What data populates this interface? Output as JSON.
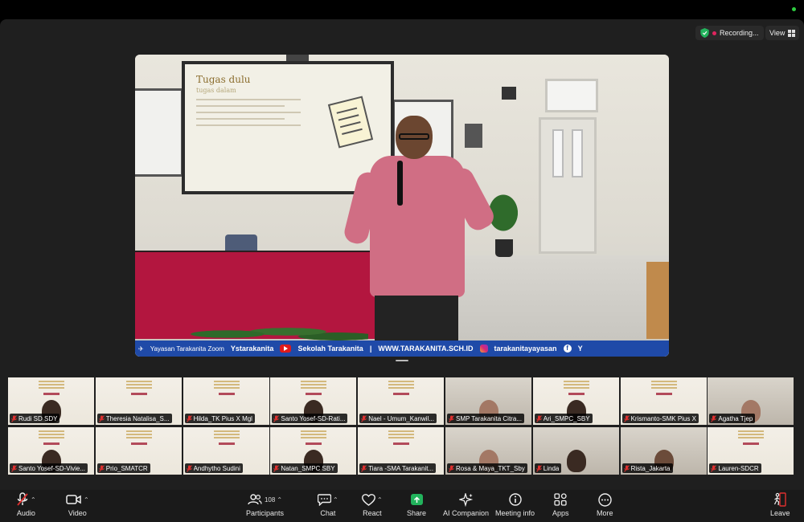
{
  "top": {
    "recording_label": "Recording...",
    "view_label": "View"
  },
  "banner": {
    "zoom_label": "Yayasan Tarakanita Zoom",
    "brand": "Ystarakanita",
    "youtube": "Sekolah Tarakanita",
    "separator": "|",
    "website": "WWW.TARAKANITA.SCH.ID",
    "instagram": "tarakanitayayasan",
    "facebook_short": "Y"
  },
  "slide": {
    "title": "Tugas dulu",
    "subtitle": "tugas dalam"
  },
  "participants": [
    {
      "name": "Rudi SD SDY",
      "cam": false
    },
    {
      "name": "Theresia Natalisa_S...",
      "cam": false
    },
    {
      "name": "Hilda_TK Pius X Mgl",
      "cam": false
    },
    {
      "name": "Santo Yosef-SD-Rati...",
      "cam": false
    },
    {
      "name": "Nael - Umum_Kanwil...",
      "cam": false
    },
    {
      "name": "SMP Tarakanita Citra...",
      "cam": true
    },
    {
      "name": "Ari_SMPC_SBY",
      "cam": false
    },
    {
      "name": "Krismanto-SMK Pius X",
      "cam": false
    },
    {
      "name": "Agatha Tjep",
      "cam": true
    },
    {
      "name": "Santo Yosef-SD-Vivie...",
      "cam": false
    },
    {
      "name": "Prio_SMATCR",
      "cam": false
    },
    {
      "name": "Andhytho Sudini",
      "cam": false
    },
    {
      "name": "Natan_SMPC SBY",
      "cam": false
    },
    {
      "name": "Tiara -SMA Tarakanit...",
      "cam": false
    },
    {
      "name": "Rosa & Maya_TKT_Sby",
      "cam": true
    },
    {
      "name": "Linda",
      "cam": true
    },
    {
      "name": "Rista_Jakarta",
      "cam": true
    },
    {
      "name": "Lauren-SDCR",
      "cam": false
    }
  ],
  "toolbar": {
    "audio": "Audio",
    "video": "Video",
    "participants": "Participants",
    "participants_count": "108",
    "chat": "Chat",
    "react": "React",
    "share": "Share",
    "ai_companion": "AI Companion",
    "meeting_info": "Meeting info",
    "apps": "Apps",
    "more": "More",
    "leave": "Leave"
  },
  "colors": {
    "app_bg": "#1f1f1f",
    "banner_blue": "#1f4aa8",
    "share_green": "#22b35c",
    "recording_red": "#e0245e",
    "muted_red": "#e0302f"
  }
}
